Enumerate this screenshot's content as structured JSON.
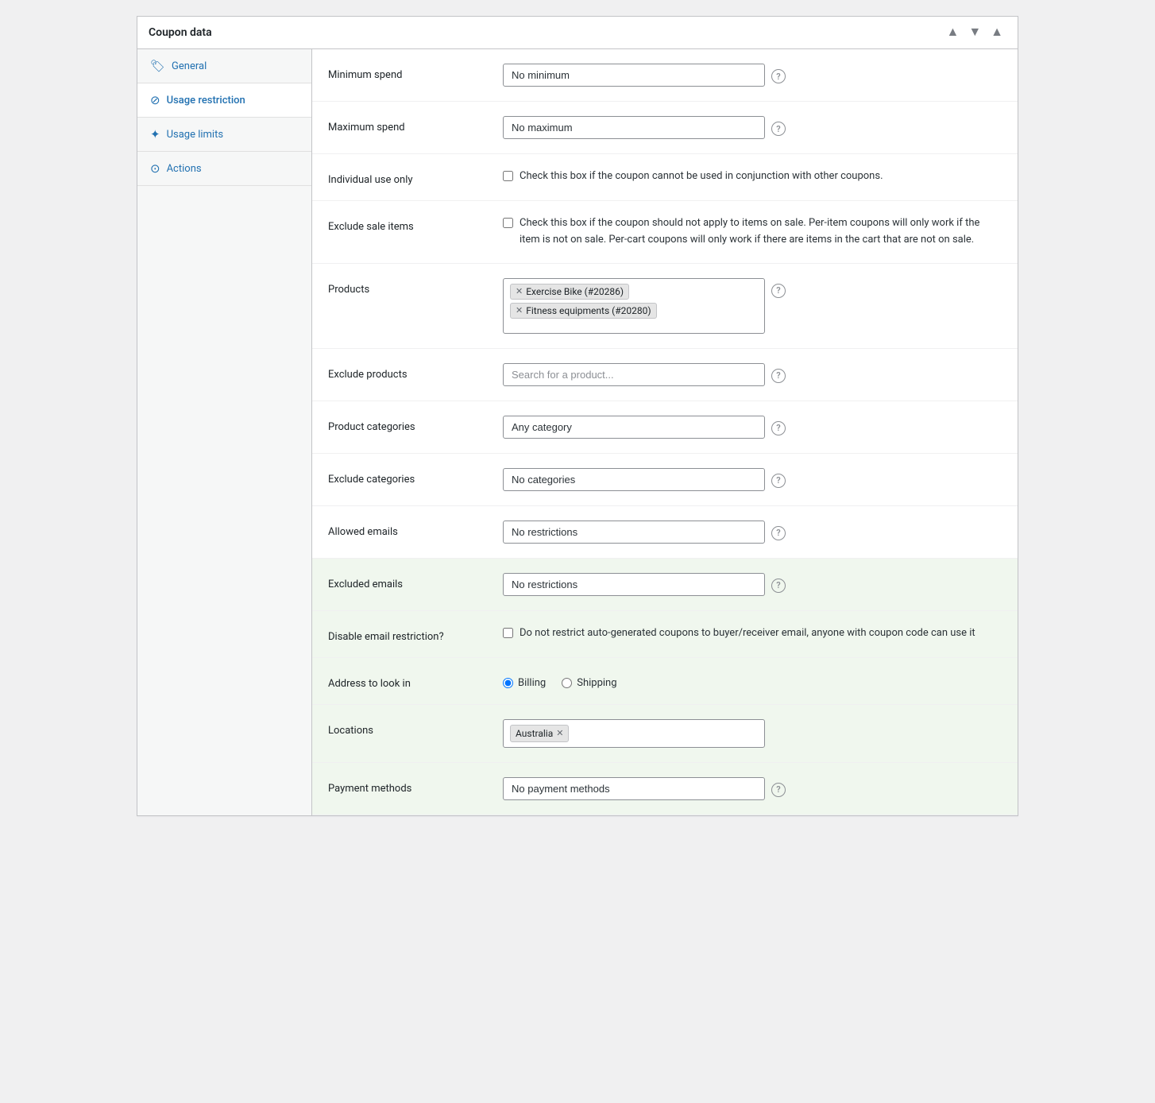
{
  "panel": {
    "title": "Coupon data"
  },
  "header_controls": {
    "up_label": "▲",
    "down_label": "▼",
    "collapse_label": "▲"
  },
  "sidebar": {
    "items": [
      {
        "id": "general",
        "label": "General",
        "icon": "🏷",
        "active": false
      },
      {
        "id": "usage-restriction",
        "label": "Usage restriction",
        "icon": "⊘",
        "active": true
      },
      {
        "id": "usage-limits",
        "label": "Usage limits",
        "icon": "✦",
        "active": false
      },
      {
        "id": "actions",
        "label": "Actions",
        "icon": "⊙",
        "active": false
      }
    ]
  },
  "form": {
    "rows": [
      {
        "id": "minimum-spend",
        "label": "Minimum spend",
        "type": "input",
        "value": "No minimum",
        "highlighted": false
      },
      {
        "id": "maximum-spend",
        "label": "Maximum spend",
        "type": "input",
        "value": "No maximum",
        "highlighted": false
      },
      {
        "id": "individual-use",
        "label": "Individual use only",
        "type": "checkbox",
        "checked": false,
        "text": "Check this box if the coupon cannot be used in conjunction with other coupons.",
        "highlighted": false
      },
      {
        "id": "exclude-sale",
        "label": "Exclude sale items",
        "type": "checkbox",
        "checked": false,
        "text": "Check this box if the coupon should not apply to items on sale. Per-item coupons will only work if the item is not on sale. Per-cart coupons will only work if there are items in the cart that are not on sale.",
        "highlighted": false
      },
      {
        "id": "products",
        "label": "Products",
        "type": "tags",
        "tags": [
          "Exercise Bike (#20286)",
          "Fitness equipments (#20280)"
        ],
        "highlighted": false
      },
      {
        "id": "exclude-products",
        "label": "Exclude products",
        "type": "input",
        "value": "",
        "placeholder": "Search for a product...",
        "highlighted": false
      },
      {
        "id": "product-categories",
        "label": "Product categories",
        "type": "input",
        "value": "Any category",
        "highlighted": false
      },
      {
        "id": "exclude-categories",
        "label": "Exclude categories",
        "type": "input",
        "value": "No categories",
        "highlighted": false
      },
      {
        "id": "allowed-emails",
        "label": "Allowed emails",
        "type": "input",
        "value": "No restrictions",
        "highlighted": false
      },
      {
        "id": "excluded-emails",
        "label": "Excluded emails",
        "type": "input",
        "value": "No restrictions",
        "highlighted": true
      },
      {
        "id": "disable-email",
        "label": "Disable email restriction?",
        "type": "checkbox",
        "checked": false,
        "text": "Do not restrict auto-generated coupons to buyer/receiver email, anyone with coupon code can use it",
        "highlighted": true
      },
      {
        "id": "address-to-look-in",
        "label": "Address to look in",
        "type": "radio",
        "options": [
          "Billing",
          "Shipping"
        ],
        "selected": "Billing",
        "highlighted": true
      },
      {
        "id": "locations",
        "label": "Locations",
        "type": "locations",
        "tags": [
          "Australia"
        ],
        "highlighted": true
      },
      {
        "id": "payment-methods",
        "label": "Payment methods",
        "type": "input",
        "value": "No payment methods",
        "highlighted": true
      }
    ]
  }
}
